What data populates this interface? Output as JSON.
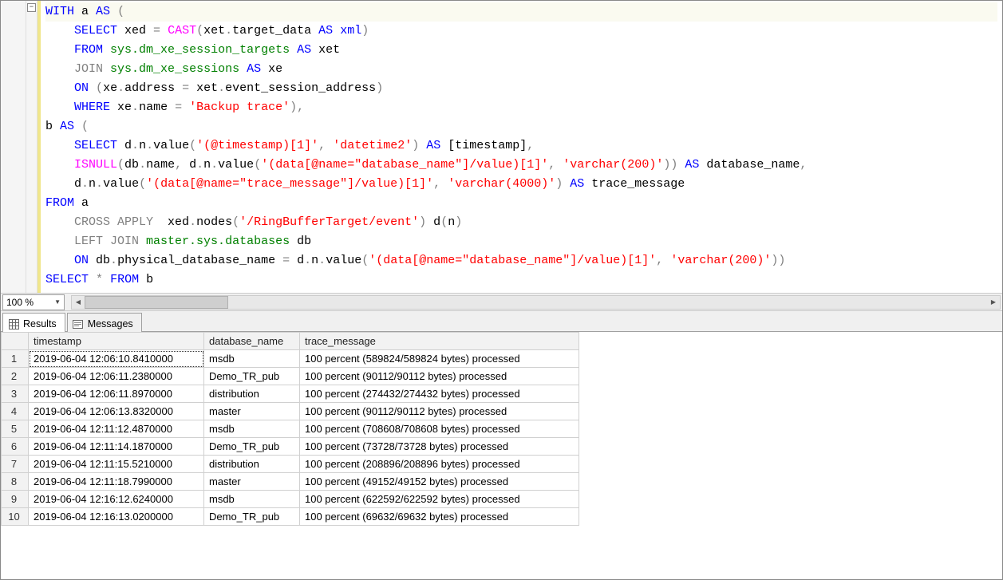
{
  "zoom": "100 %",
  "tabs": {
    "results": "Results",
    "messages": "Messages"
  },
  "columns": {
    "timestamp": "timestamp",
    "database_name": "database_name",
    "trace_message": "trace_message"
  },
  "rows": [
    {
      "n": "1",
      "ts": "2019-06-04 12:06:10.8410000",
      "db": "msdb",
      "msg": "100 percent (589824/589824 bytes) processed"
    },
    {
      "n": "2",
      "ts": "2019-06-04 12:06:11.2380000",
      "db": "Demo_TR_pub",
      "msg": "100 percent (90112/90112 bytes) processed"
    },
    {
      "n": "3",
      "ts": "2019-06-04 12:06:11.8970000",
      "db": "distribution",
      "msg": "100 percent (274432/274432 bytes) processed"
    },
    {
      "n": "4",
      "ts": "2019-06-04 12:06:13.8320000",
      "db": "master",
      "msg": "100 percent (90112/90112 bytes) processed"
    },
    {
      "n": "5",
      "ts": "2019-06-04 12:11:12.4870000",
      "db": "msdb",
      "msg": "100 percent (708608/708608 bytes) processed"
    },
    {
      "n": "6",
      "ts": "2019-06-04 12:11:14.1870000",
      "db": "Demo_TR_pub",
      "msg": "100 percent (73728/73728 bytes) processed"
    },
    {
      "n": "7",
      "ts": "2019-06-04 12:11:15.5210000",
      "db": "distribution",
      "msg": "100 percent (208896/208896 bytes) processed"
    },
    {
      "n": "8",
      "ts": "2019-06-04 12:11:18.7990000",
      "db": "master",
      "msg": "100 percent (49152/49152 bytes) processed"
    },
    {
      "n": "9",
      "ts": "2019-06-04 12:16:12.6240000",
      "db": "msdb",
      "msg": "100 percent (622592/622592 bytes) processed"
    },
    {
      "n": "10",
      "ts": "2019-06-04 12:16:13.0200000",
      "db": "Demo_TR_pub",
      "msg": "100 percent (69632/69632 bytes) processed"
    }
  ],
  "sql": {
    "l1": {
      "a": "WITH",
      "b": " a ",
      "c": "AS",
      "d": " ",
      "e": "("
    },
    "l2": {
      "a": "    ",
      "b": "SELECT",
      "c": " xed ",
      "d": "=",
      "e": " ",
      "f": "CAST",
      "g": "(",
      "h": "xet",
      "i": ".",
      "j": "target_data ",
      "k": "AS",
      "l": " ",
      "m": "xml",
      "n": ")"
    },
    "l3": {
      "a": "    ",
      "b": "FROM",
      "c": " ",
      "d": "sys.dm_xe_session_targets",
      "e": " ",
      "f": "AS",
      "g": " xet"
    },
    "l4": {
      "a": "    ",
      "b": "JOIN",
      "c": " ",
      "d": "sys.dm_xe_sessions",
      "e": " ",
      "f": "AS",
      "g": " xe"
    },
    "l5": {
      "a": "    ",
      "b": "ON",
      "c": " ",
      "d": "(",
      "e": "xe",
      "f": ".",
      "g": "address ",
      "h": "=",
      "i": " xet",
      "j": ".",
      "k": "event_session_address",
      "l": ")"
    },
    "l6": {
      "a": "    ",
      "b": "WHERE",
      "c": " xe",
      "d": ".",
      "e": "name",
      "f": " ",
      "g": "=",
      "h": " ",
      "i": "'Backup trace'",
      "j": "),"
    },
    "l7": {
      "a": "b ",
      "b": "AS",
      "c": " ",
      "d": "("
    },
    "l8": {
      "a": "    ",
      "b": "SELECT",
      "c": " d",
      "d": ".",
      "e": "n",
      "f": ".",
      "g": "value",
      "h": "(",
      "i": "'(@timestamp)[1]'",
      "j": ",",
      "k": " ",
      "l": "'datetime2'",
      "m": ")",
      "n": " ",
      "o": "AS",
      "p": " [timestamp]",
      "q": ","
    },
    "l9": {
      "a": "    ",
      "b": "ISNULL",
      "c": "(",
      "d": "db",
      "e": ".",
      "f": "name",
      "g": ",",
      "h": " d",
      "i": ".",
      "j": "n",
      "k": ".",
      "l": "value",
      "m": "(",
      "n": "'(data[@name=\"database_name\"]/value)[1]'",
      "o": ",",
      "p": " ",
      "q": "'varchar(200)'",
      "r": "))",
      "s": " ",
      "t": "AS",
      "u": " database_name",
      "v": ","
    },
    "l10": {
      "a": "    d",
      "b": ".",
      "c": "n",
      "d": ".",
      "e": "value",
      "f": "(",
      "g": "'(data[@name=\"trace_message\"]/value)[1]'",
      "h": ",",
      "i": " ",
      "j": "'varchar(4000)'",
      "k": ")",
      "l": " ",
      "m": "AS",
      "n": " trace_message"
    },
    "l11": {
      "a": "FROM",
      "b": " a"
    },
    "l12": {
      "a": "    ",
      "b": "CROSS APPLY",
      "c": "  xed",
      "d": ".",
      "e": "nodes",
      "f": "(",
      "g": "'/RingBufferTarget/event'",
      "h": ")",
      "i": " d",
      "j": "(",
      "k": "n",
      "l": ")"
    },
    "l13": {
      "a": "    ",
      "b": "LEFT JOIN",
      "c": " ",
      "d": "master.sys.databases",
      "e": " db"
    },
    "l14": {
      "a": "    ",
      "b": "ON",
      "c": " db",
      "d": ".",
      "e": "physical_database_name ",
      "f": "=",
      "g": " d",
      "h": ".",
      "i": "n",
      "j": ".",
      "k": "value",
      "l": "(",
      "m": "'(data[@name=\"database_name\"]/value)[1]'",
      "n": ",",
      "o": " ",
      "p": "'varchar(200)'",
      "q": "))"
    },
    "l15": {
      "a": "SELECT",
      "b": " ",
      "c": "*",
      "d": " ",
      "e": "FROM",
      "f": " b"
    }
  }
}
